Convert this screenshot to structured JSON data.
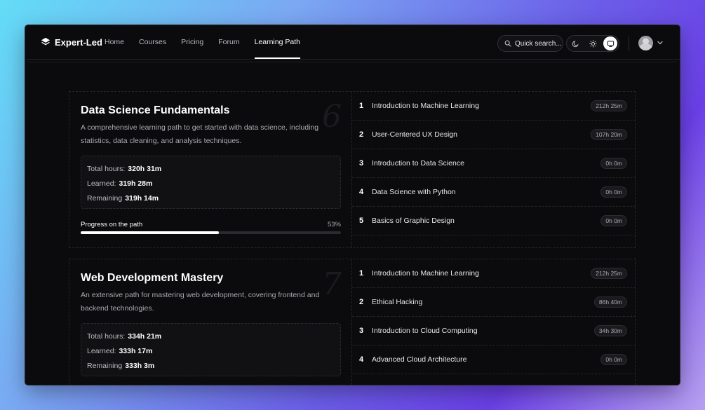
{
  "brand": {
    "name": "Expert-Led"
  },
  "nav": {
    "links": [
      {
        "label": "Home",
        "active": false
      },
      {
        "label": "Courses",
        "active": false
      },
      {
        "label": "Pricing",
        "active": false
      },
      {
        "label": "Forum",
        "active": false
      },
      {
        "label": "Learning Path",
        "active": true
      }
    ]
  },
  "search": {
    "label": "Quick search..."
  },
  "theme": {
    "options": [
      "moon-icon",
      "sun-icon",
      "monitor-icon"
    ],
    "selected": "monitor-icon"
  },
  "colors": {
    "background": "#0b0b0d",
    "accent": "#ffffff",
    "muted": "#a9a9b0"
  },
  "paths": [
    {
      "number": "6",
      "title": "Data Science Fundamentals",
      "description": "A comprehensive learning path to get started with data science, including statistics, data cleaning, and analysis techniques.",
      "stats": {
        "total_label": "Total hours:",
        "total": "320h 31m",
        "learned_label": "Learned:",
        "learned": "319h 28m",
        "remaining_label": "Remaining",
        "remaining": "319h 14m"
      },
      "progress": {
        "label": "Progress on the path",
        "percent_text": "53%",
        "value": 0.53
      },
      "courses": [
        {
          "index": "1",
          "name": "Introduction to Machine Learning",
          "duration": "212h 25m"
        },
        {
          "index": "2",
          "name": "User-Centered UX Design",
          "duration": "107h 20m"
        },
        {
          "index": "3",
          "name": "Introduction to Data Science",
          "duration": "0h 0m"
        },
        {
          "index": "4",
          "name": "Data Science with Python",
          "duration": "0h 0m"
        },
        {
          "index": "5",
          "name": "Basics of Graphic Design",
          "duration": "0h 0m"
        }
      ]
    },
    {
      "number": "7",
      "title": "Web Development Mastery",
      "description": "An extensive path for mastering web development, covering frontend and backend technologies.",
      "stats": {
        "total_label": "Total hours:",
        "total": "334h 21m",
        "learned_label": "Learned:",
        "learned": "333h 17m",
        "remaining_label": "Remaining",
        "remaining": "333h 3m"
      },
      "courses": [
        {
          "index": "1",
          "name": "Introduction to Machine Learning",
          "duration": "212h 25m"
        },
        {
          "index": "2",
          "name": "Ethical Hacking",
          "duration": "86h 40m"
        },
        {
          "index": "3",
          "name": "Introduction to Cloud Computing",
          "duration": "34h 30m"
        },
        {
          "index": "4",
          "name": "Advanced Cloud Architecture",
          "duration": "0h 0m"
        }
      ]
    }
  ]
}
